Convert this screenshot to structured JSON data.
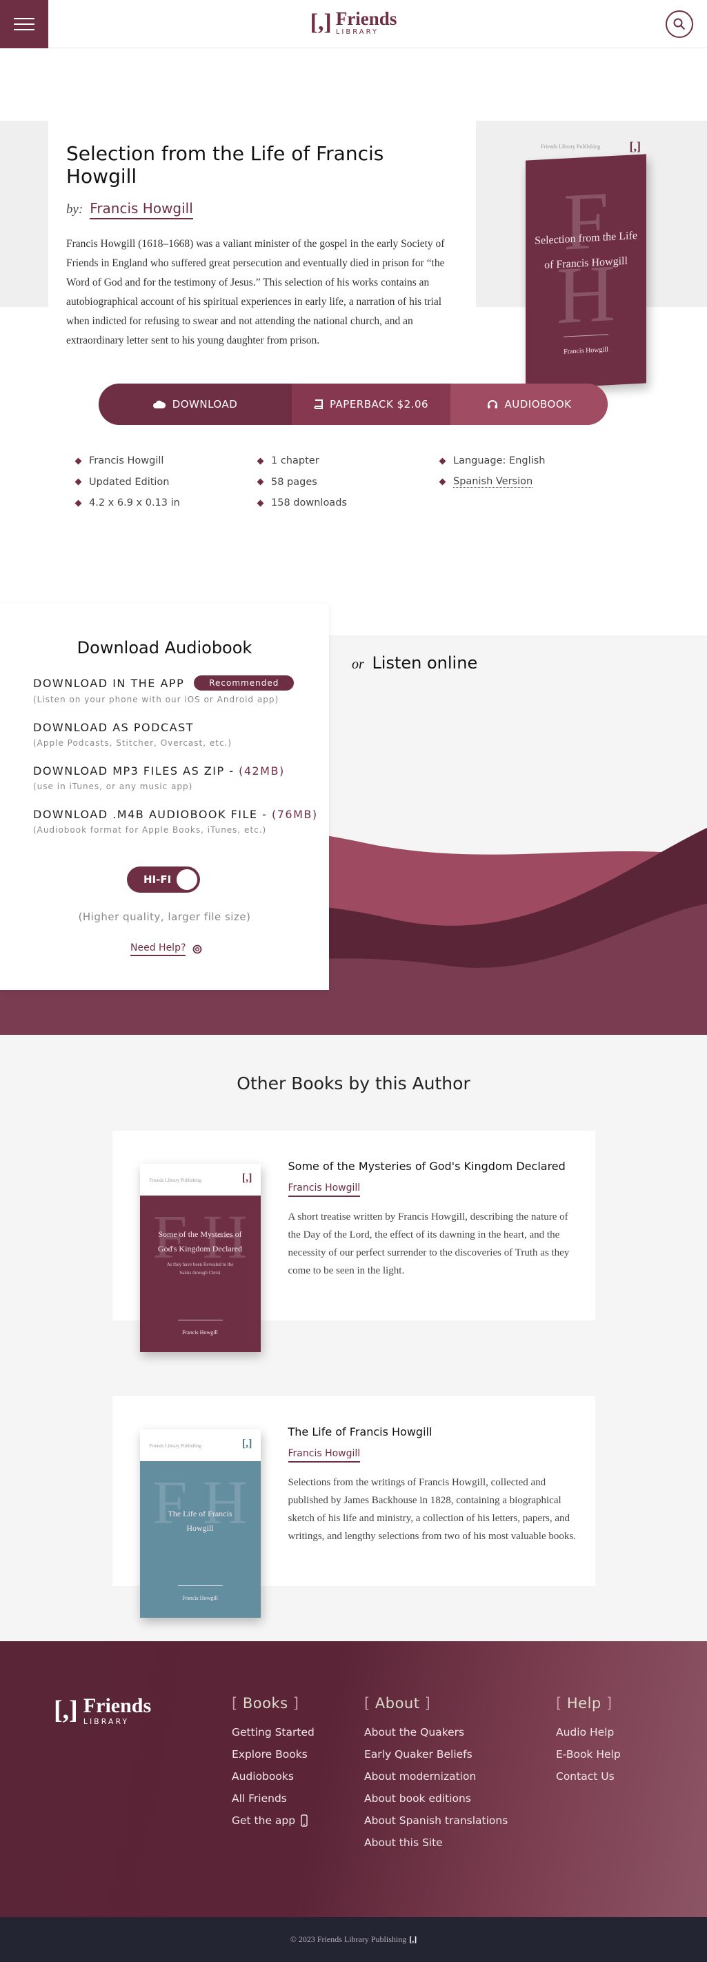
{
  "header": {
    "logo_mark": "[,]",
    "logo_word": "Friends",
    "logo_sub": "LIBRARY"
  },
  "book": {
    "title": "Selection from the Life of Francis Howgill",
    "by_label": "by:",
    "author": "Francis Howgill",
    "description": "Francis Howgill (1618–1668) was a valiant minister of the gospel in the early Society of Friends in England who suffered great persecution and eventually died in prison for “the Word of God and for the testimony of Jesus.” This selection of his works contains an autobiographical account of his spiritual experiences in early life, a narration of his trial when indicted for refusing to swear and not attending the national church, and an extraordinary letter sent to his young daughter from prison.",
    "cover": {
      "publisher": "Friends Library Publishing",
      "mark": "[,]",
      "ghost": "F H",
      "title": "Selection from the Life of Francis Howgill",
      "author": "Francis Howgill",
      "color": "#6e2f45"
    }
  },
  "actions": {
    "download": "DOWNLOAD",
    "paperback": "PAPERBACK $2.06",
    "audiobook": "AUDIOBOOK"
  },
  "meta": [
    "Francis Howgill",
    "1 chapter",
    "Language: English",
    "Updated Edition",
    "58 pages",
    "Spanish Version",
    "4.2 x 6.9 x 0.13 in",
    "158 downloads"
  ],
  "audio": {
    "heading": "Download Audiobook",
    "options": [
      {
        "title": "DOWNLOAD IN THE APP",
        "size": "",
        "badge": "Recommended",
        "desc": "(Listen on your phone with our iOS or Android app)"
      },
      {
        "title": "DOWNLOAD AS PODCAST",
        "size": "",
        "badge": "",
        "desc": "(Apple Podcasts, Stitcher, Overcast, etc.)"
      },
      {
        "title": "DOWNLOAD MP3 FILES AS ZIP - ",
        "size": "(42MB)",
        "badge": "",
        "desc": "(use in iTunes, or any music app)"
      },
      {
        "title": "DOWNLOAD .M4B AUDIOBOOK FILE - ",
        "size": "(76MB)",
        "badge": "",
        "desc": "(Audiobook format for Apple Books, iTunes, etc.)"
      }
    ],
    "hifi_label": "HI-FI",
    "quality_note": "(Higher quality, larger file size)",
    "help": "Need Help?",
    "listen_or": "or",
    "listen_online": "Listen online"
  },
  "others": {
    "heading": "Other Books by this Author",
    "books": [
      {
        "title": "Some of the Mysteries of God's Kingdom Declared",
        "author": "Francis Howgill",
        "desc": "A short treatise written by Francis Howgill, describing the nature of the Day of the Lord, the effect of its dawning in the heart, and the necessity of our perfect surrender to the discoveries of Truth as they come to be seen in the light.",
        "cover_title": "Some of the Mysteries of God's Kingdom Declared",
        "cover_sub": "As they have been Revealed to the Saints through Christ",
        "cover_color": "#6e2f45",
        "publisher": "Friends Library Publishing",
        "mark": "[,]",
        "ghost": "F H"
      },
      {
        "title": "The Life of Francis Howgill",
        "author": "Francis Howgill",
        "desc": "Selections from the writings of Francis Howgill, collected and published by James Backhouse in 1828, containing a biographical sketch of his life and ministry, a collection of his letters, papers, and writings, and lengthy selections from two of his most valuable books.",
        "cover_title": "The Life of Francis Howgill",
        "cover_sub": "",
        "cover_color": "#638ea0",
        "publisher": "Friends Library Publishing",
        "mark": "[,]",
        "ghost": "F H"
      }
    ]
  },
  "footer": {
    "logo_mark": "[,]",
    "logo_word": "Friends",
    "logo_sub": "LIBRARY",
    "books": {
      "heading": "Books",
      "items": [
        "Getting Started",
        "Explore Books",
        "Audiobooks",
        "All Friends",
        "Get the app"
      ]
    },
    "about": {
      "heading": "About",
      "items": [
        "About the Quakers",
        "Early Quaker Beliefs",
        "About modernization",
        "About book editions",
        "About Spanish translations",
        "About this Site"
      ]
    },
    "help": {
      "heading": "Help",
      "items": [
        "Audio Help",
        "E-Book Help",
        "Contact Us"
      ]
    },
    "copyright": "© 2023 Friends Library Publishing",
    "copyright_mark": "[,]"
  }
}
